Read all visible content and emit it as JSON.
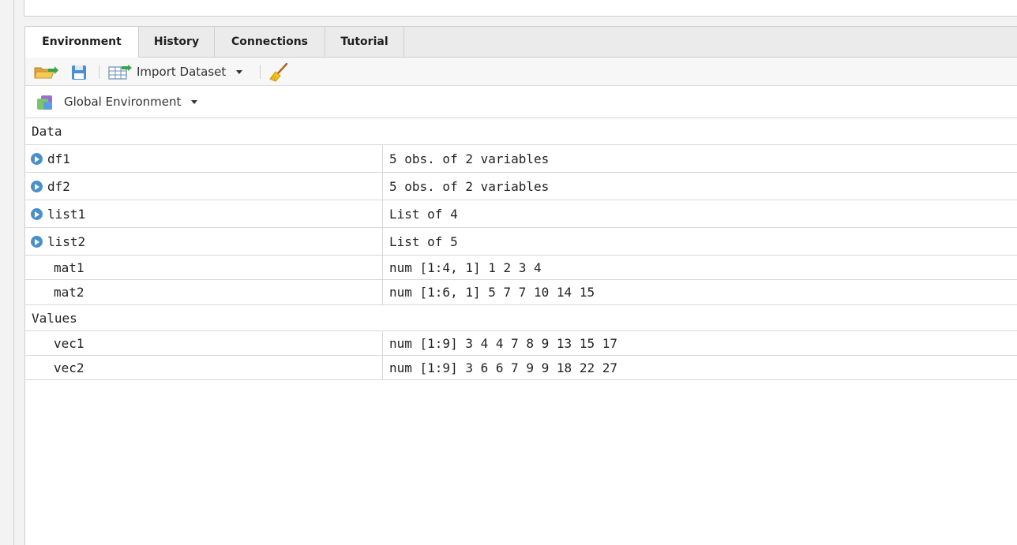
{
  "tabs": [
    "Environment",
    "History",
    "Connections",
    "Tutorial"
  ],
  "toolbar": {
    "open_icon": "folder-open-icon",
    "save_icon": "floppy-save-icon",
    "import_icon": "table-import-icon",
    "import_label": "Import Dataset",
    "clear_icon": "broom-icon"
  },
  "env": {
    "label": "Global Environment",
    "icon": "environment-stack-icon"
  },
  "sections": {
    "data_title": "Data",
    "values_title": "Values"
  },
  "data_rows": [
    {
      "name": "df1",
      "value": "5 obs. of 2 variables",
      "expandable": true
    },
    {
      "name": "df2",
      "value": "5 obs. of 2 variables",
      "expandable": true
    },
    {
      "name": "list1",
      "value": "List of 4",
      "expandable": true
    },
    {
      "name": "list2",
      "value": "List of 5",
      "expandable": true
    },
    {
      "name": "mat1",
      "value": "num [1:4, 1] 1 2 3 4",
      "expandable": false
    },
    {
      "name": "mat2",
      "value": "num [1:6, 1] 5 7 7 10 14 15",
      "expandable": false
    }
  ],
  "value_rows": [
    {
      "name": "vec1",
      "value": "num [1:9] 3 4 4 7 8 9 13 15 17"
    },
    {
      "name": "vec2",
      "value": "num [1:9] 3 6 6 7 9 9 18 22 27"
    }
  ],
  "colors": {
    "accent": "#4a90c8",
    "tab_bar": "#ebebeb",
    "border": "#d8d8d8"
  }
}
